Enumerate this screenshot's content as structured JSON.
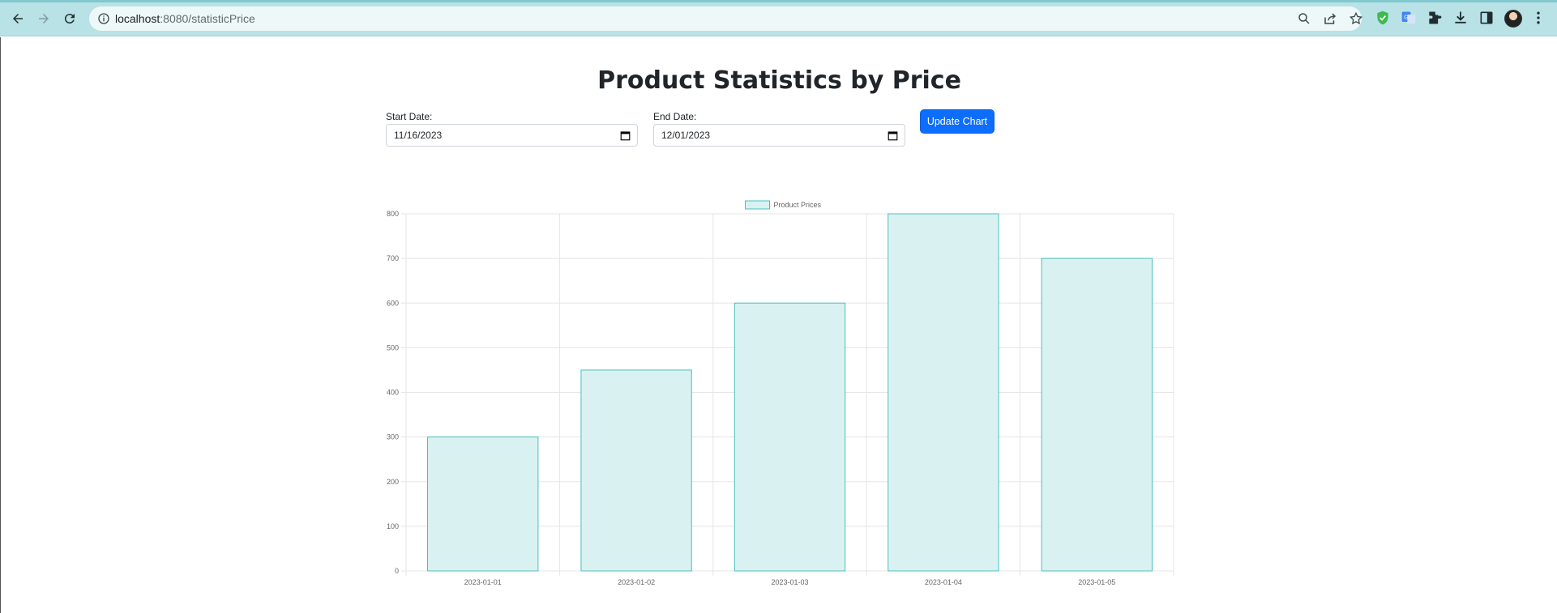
{
  "browser": {
    "url_host": "localhost",
    "url_path": ":8080/statisticPrice"
  },
  "page": {
    "title": "Product Statistics by Price"
  },
  "form": {
    "start_label": "Start Date:",
    "start_value": "11/16/2023",
    "end_label": "End Date:",
    "end_value": "12/01/2023",
    "update_label": "Update Chart"
  },
  "colors": {
    "bar_fill": "#d9f1f1",
    "bar_border": "#4bc0c0",
    "button": "#0d6efd"
  },
  "chart_data": {
    "type": "bar",
    "categories": [
      "2023-01-01",
      "2023-01-02",
      "2023-01-03",
      "2023-01-04",
      "2023-01-05"
    ],
    "series": [
      {
        "name": "Product Prices",
        "values": [
          300,
          450,
          600,
          800,
          700
        ]
      }
    ],
    "ylim": [
      0,
      800
    ],
    "yticks": [
      0,
      100,
      200,
      300,
      400,
      500,
      600,
      700,
      800
    ],
    "grid": true,
    "legend": "top-center"
  }
}
